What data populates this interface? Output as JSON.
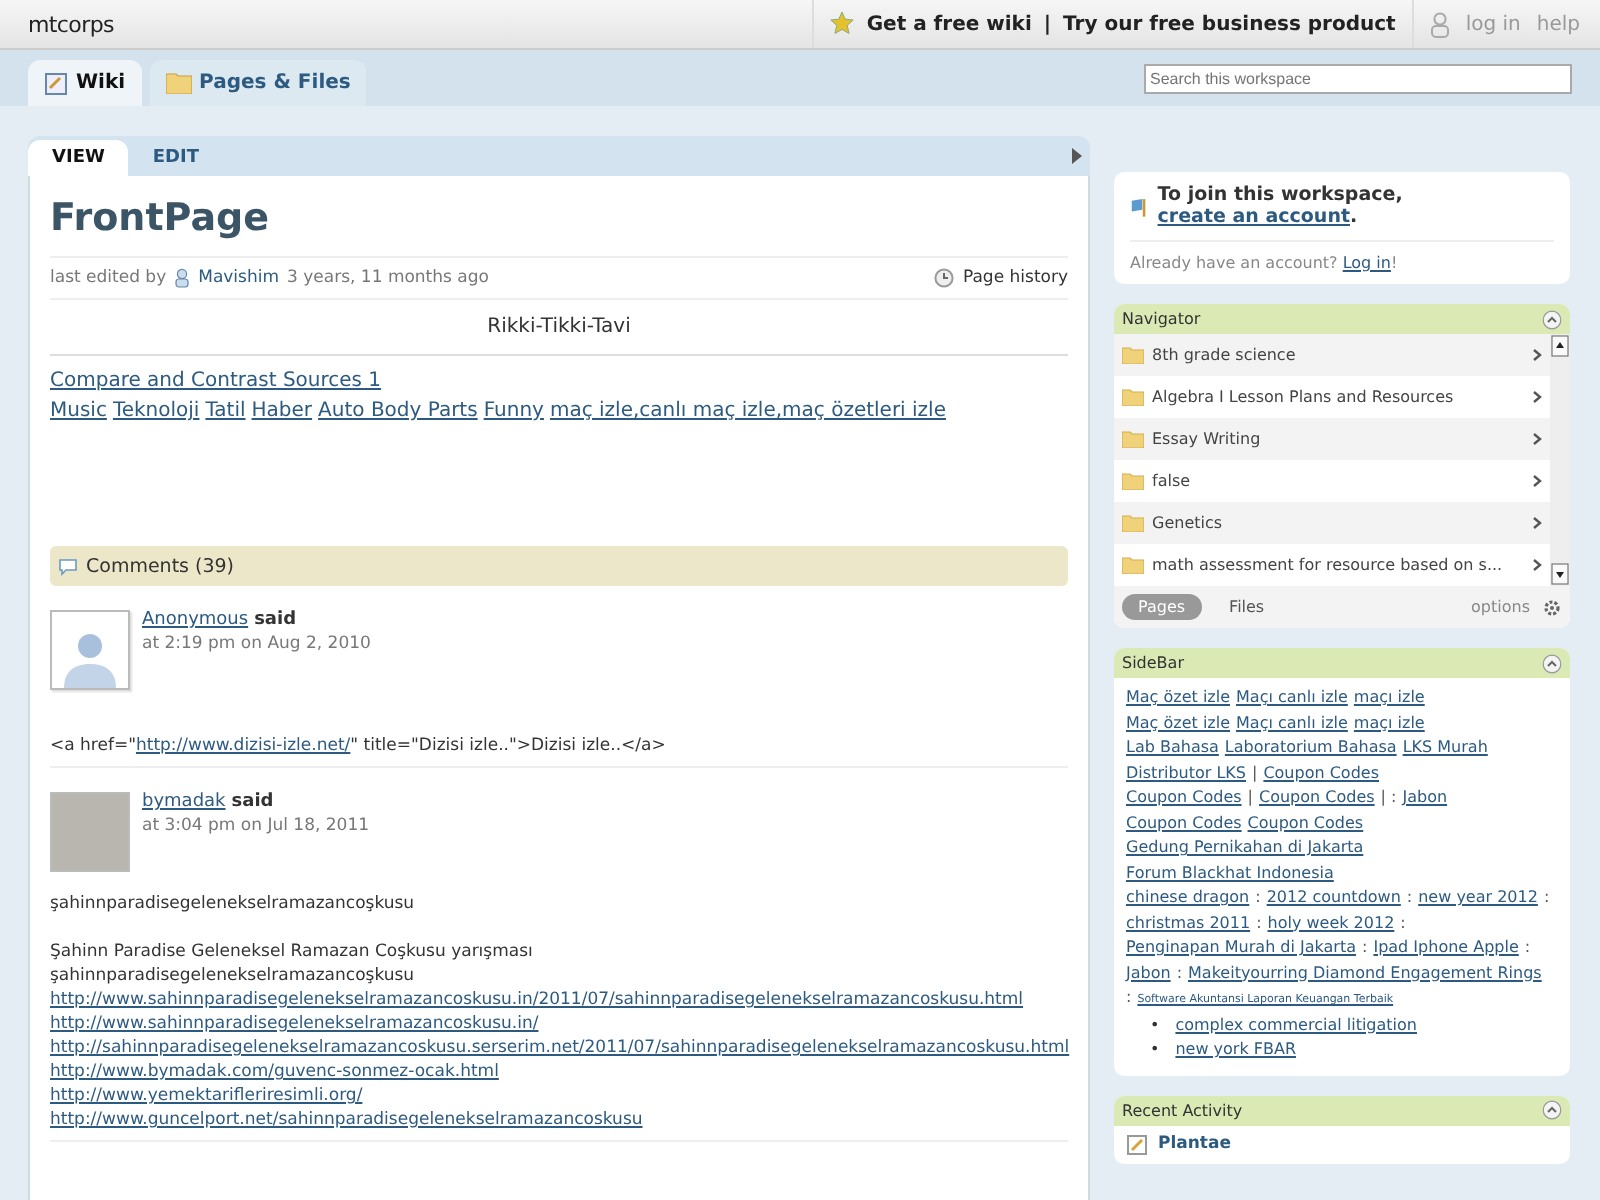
{
  "header": {
    "workspace": "mtcorps",
    "promo": "Get a free wiki",
    "separator": "|",
    "business": "Try our free business product",
    "login": "log in",
    "help": "help"
  },
  "nav_tabs": [
    {
      "label": "Wiki",
      "selected": true
    },
    {
      "label": "Pages & Files",
      "selected": false
    }
  ],
  "search": {
    "placeholder": "Search this workspace"
  },
  "page_tabs": [
    {
      "label": "VIEW",
      "selected": true
    },
    {
      "label": "EDIT",
      "selected": false
    }
  ],
  "page": {
    "title": "FrontPage",
    "edited_prefix": "last edited by",
    "author": "Mavishim",
    "edited_ago": "3 years, 11 months ago",
    "history": "Page history",
    "heading": "Rikki-Tikki-Tavi",
    "link_lines": [
      [
        "Compare and Contrast Sources 1"
      ],
      [
        "Music",
        "Teknoloji",
        "Tatil",
        "Haber",
        "Auto Body Parts",
        "Funny",
        "maç izle,canlı maç izle,maç özetleri izle"
      ]
    ]
  },
  "comments": {
    "title": "Comments (39)",
    "items": [
      {
        "author": "Anonymous",
        "said": "said",
        "time": "at 2:19 pm on Aug 2, 2010",
        "kind": "silhouette",
        "body": [
          {
            "kind": "text",
            "text": "<a href=\""
          },
          {
            "kind": "link",
            "text": "http://www.dizisi-izle.net/"
          },
          {
            "kind": "text",
            "text": "\" title=\"Dizisi izle..\">Dizisi izle..</a>"
          }
        ]
      },
      {
        "author": "bymadak",
        "said": "said",
        "time": "at 3:04 pm on Jul 18, 2011",
        "kind": "photo",
        "body": [
          {
            "kind": "para",
            "text": "şahinnparadisegelenekselramazancoşkusu"
          },
          {
            "kind": "gap"
          },
          {
            "kind": "line",
            "text": "Şahinn Paradise Geleneksel Ramazan Coşkusu yarışması"
          },
          {
            "kind": "line",
            "text": "şahinnparadisegelenekselramazancoşkusu"
          },
          {
            "kind": "linkline",
            "text": "http://www.sahinnparadisegelenekselramazancoskusu.in/2011/07/sahinnparadisegelenekselramazancoskusu.html"
          },
          {
            "kind": "linkline",
            "text": "http://www.sahinnparadisegelenekselramazancoskusu.in/"
          },
          {
            "kind": "linkline",
            "text": "http://sahinnparadisegelenekselramazancoskusu.serserim.net/2011/07/sahinnparadisegelenekselramazancoskusu.html"
          },
          {
            "kind": "linkline",
            "text": "http://www.bymadak.com/guvenc-sonmez-ocak.html"
          },
          {
            "kind": "linkline",
            "text": "http://www.yemektarifleriresimli.org/"
          },
          {
            "kind": "linkline",
            "text": "http://www.guncelport.net/sahinnparadisegelenekselramazancoskusu"
          }
        ]
      }
    ]
  },
  "join": {
    "prefix": "To join this workspace,",
    "link": "create an account",
    "suffix": ".",
    "question": "Already have an account?",
    "login": "Log in",
    "after": "!"
  },
  "navigator": {
    "title": "Navigator",
    "items": [
      "8th grade science",
      "Algebra I Lesson Plans and Resources",
      "Essay Writing",
      "false",
      "Genetics",
      "math assessment for resource based on s..."
    ],
    "tabs": [
      {
        "label": "Pages",
        "selected": true
      },
      {
        "label": "Files",
        "selected": false
      }
    ],
    "options": "options"
  },
  "sidebar": {
    "title": "SideBar",
    "segments": [
      {
        "kind": "link",
        "text": "Maç özet izle"
      },
      {
        "kind": "link",
        "text": "Maçı canlı izle"
      },
      {
        "kind": "link",
        "text": "maçı izle"
      },
      {
        "kind": "break"
      },
      {
        "kind": "link",
        "text": "Maç özet izle"
      },
      {
        "kind": "link",
        "text": "Maçı canlı izle"
      },
      {
        "kind": "link",
        "text": "maçı izle"
      },
      {
        "kind": "break"
      },
      {
        "kind": "link",
        "text": "Lab Bahasa"
      },
      {
        "kind": "link",
        "text": "Laboratorium Bahasa"
      },
      {
        "kind": "link",
        "text": "LKS Murah"
      },
      {
        "kind": "link",
        "text": "Distributor LKS"
      },
      {
        "kind": "text",
        "text": "|"
      },
      {
        "kind": "link",
        "text": "Coupon Codes"
      },
      {
        "kind": "break"
      },
      {
        "kind": "link",
        "text": "Coupon Codes"
      },
      {
        "kind": "text",
        "text": "|"
      },
      {
        "kind": "link",
        "text": "Coupon Codes"
      },
      {
        "kind": "text",
        "text": "| :"
      },
      {
        "kind": "link",
        "text": "Jabon"
      },
      {
        "kind": "link",
        "text": "Coupon Codes"
      },
      {
        "kind": "link",
        "text": "Coupon Codes"
      },
      {
        "kind": "link",
        "text": "Gedung Pernikahan di Jakarta"
      },
      {
        "kind": "link",
        "text": "Forum Blackhat Indonesia"
      },
      {
        "kind": "break"
      },
      {
        "kind": "link",
        "text": "chinese dragon"
      },
      {
        "kind": "text",
        "text": ":"
      },
      {
        "kind": "link",
        "text": "2012 countdown"
      },
      {
        "kind": "text",
        "text": ":"
      },
      {
        "kind": "link",
        "text": "new year 2012"
      },
      {
        "kind": "text",
        "text": ":"
      },
      {
        "kind": "link",
        "text": "christmas 2011"
      },
      {
        "kind": "text",
        "text": ":"
      },
      {
        "kind": "link",
        "text": "holy week 2012"
      },
      {
        "kind": "text",
        "text": ":"
      },
      {
        "kind": "link",
        "text": "Penginapan Murah di Jakarta"
      },
      {
        "kind": "text",
        "text": ":"
      },
      {
        "kind": "link",
        "text": "Ipad Iphone Apple"
      },
      {
        "kind": "text",
        "text": ":"
      },
      {
        "kind": "link",
        "text": "Jabon"
      },
      {
        "kind": "text",
        "text": ":"
      },
      {
        "kind": "link",
        "text": "Makeityourring Diamond Engagement Rings"
      },
      {
        "kind": "text",
        "text": ":"
      },
      {
        "kind": "small_link",
        "text": "Software Akuntansi Laporan Keuangan Terbaik"
      }
    ],
    "bullet_marker": "•",
    "bullets": [
      "complex commercial litigation",
      "new york FBAR"
    ]
  },
  "recent": {
    "title": "Recent Activity",
    "items": [
      "Plantae"
    ]
  }
}
